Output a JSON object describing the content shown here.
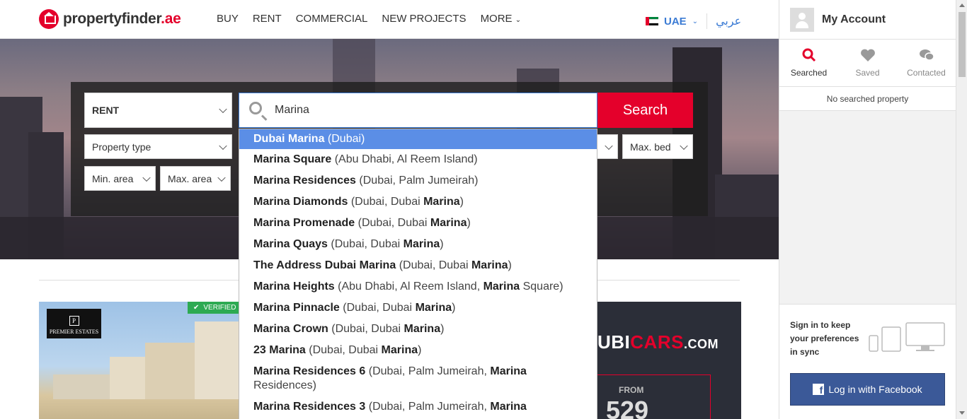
{
  "header": {
    "logo": {
      "brand": "propertyfinder",
      "tld": ".ae"
    },
    "nav": [
      "BUY",
      "RENT",
      "COMMERCIAL",
      "NEW PROJECTS",
      "MORE"
    ],
    "country": "UAE",
    "language_link": "عربي"
  },
  "search": {
    "mode": "RENT",
    "property_type": "Property type",
    "query": "Marina",
    "button": "Search",
    "max_bed": "Max. bed",
    "min_area": "Min. area",
    "max_area": "Max. area"
  },
  "suggestions": [
    {
      "name": "Dubai Marina",
      "location": "(Dubai)"
    },
    {
      "name": "Marina Square",
      "location": "(Abu Dhabi, Al Reem Island)"
    },
    {
      "name": "Marina Residences",
      "location": "(Dubai, Palm Jumeirah)"
    },
    {
      "name": "Marina Diamonds",
      "location_pre": "(Dubai, Dubai ",
      "location_hl": "Marina",
      "location_post": ")"
    },
    {
      "name": "Marina Promenade",
      "location_pre": "(Dubai, Dubai ",
      "location_hl": "Marina",
      "location_post": ")"
    },
    {
      "name": "Marina Quays",
      "location_pre": "(Dubai, Dubai ",
      "location_hl": "Marina",
      "location_post": ")"
    },
    {
      "name": "The Address Dubai Marina",
      "location_pre": "(Dubai, Dubai ",
      "location_hl": "Marina",
      "location_post": ")"
    },
    {
      "name": "Marina Heights",
      "location_pre": "(Abu Dhabi, Al Reem Island, ",
      "location_hl": "Marina",
      "location_post": " Square)"
    },
    {
      "name": "Marina Pinnacle",
      "location_pre": "(Dubai, Dubai ",
      "location_hl": "Marina",
      "location_post": ")"
    },
    {
      "name": "Marina Crown",
      "location_pre": "(Dubai, Dubai ",
      "location_hl": "Marina",
      "location_post": ")"
    },
    {
      "name": "23 Marina",
      "location_pre": "(Dubai, Dubai ",
      "location_hl": "Marina",
      "location_post": ")"
    },
    {
      "name": "Marina Residences 6",
      "location_pre": "(Dubai, Palm Jumeirah, ",
      "location_hl": "Marina",
      "location_post": " Residences)"
    },
    {
      "name": "Marina Residences 3",
      "location_pre": "(Dubai, Palm Jumeirah, ",
      "location_hl": "Marina",
      "location_post": ""
    }
  ],
  "listing": {
    "verified": "VERIFIED",
    "agency": "PREMIER ESTATES"
  },
  "ad": {
    "logo_white": "UBI",
    "logo_red": "CARS",
    "logo_suffix": ".COM",
    "from": "FROM",
    "price": "529"
  },
  "sidebar": {
    "title": "My Account",
    "tabs": [
      "Searched",
      "Saved",
      "Contacted"
    ],
    "empty": "No searched property",
    "sync_text": "Sign in to keep your preferences in sync",
    "facebook": "Log in with Facebook"
  },
  "colors": {
    "brand": "#e4002b",
    "link": "#3b7bd4",
    "highlight": "#5b8ee6",
    "facebook": "#3b5998"
  }
}
